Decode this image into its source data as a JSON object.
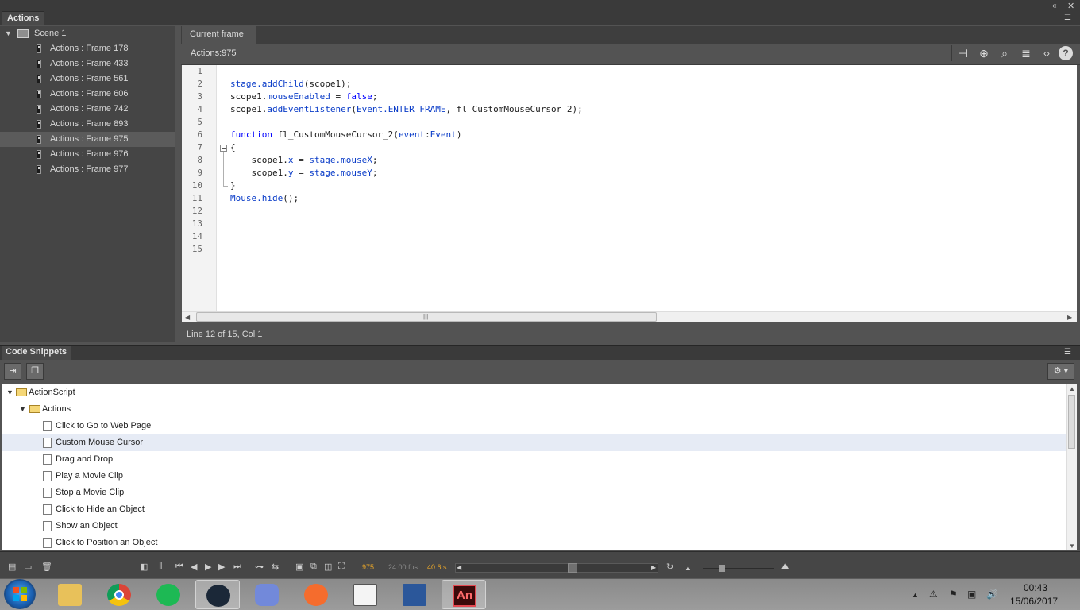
{
  "actions_panel": {
    "title": "Actions"
  },
  "tree": {
    "scene": "Scene 1",
    "items": [
      "Actions : Frame 178",
      "Actions : Frame 433",
      "Actions : Frame 561",
      "Actions : Frame 606",
      "Actions : Frame 742",
      "Actions : Frame 893",
      "Actions : Frame 975",
      "Actions : Frame 976",
      "Actions : Frame 977"
    ],
    "selected_index": 6
  },
  "editor": {
    "tab": "Current frame",
    "crumb": "Actions:975",
    "line_numbers": [
      "1",
      "2",
      "3",
      "4",
      "5",
      "6",
      "7",
      "8",
      "9",
      "10",
      "11",
      "12",
      "13",
      "14",
      "15"
    ],
    "status": "Line 12 of 15, Col 1"
  },
  "code": {
    "l2a": "stage.addChild",
    "l2b": "(scope1);",
    "l3a": "scope1.",
    "l3b": "mouseEnabled",
    "l3c": " = ",
    "l3d": "false",
    "l3e": ";",
    "l4a": "scope1.",
    "l4b": "addEventListener",
    "l4c": "(",
    "l4d": "Event.ENTER_FRAME",
    "l4e": ", fl_CustomMouseCursor_2);",
    "l6a": "function",
    "l6b": " fl_CustomMouseCursor_2(",
    "l6c": "event",
    "l6d": ":",
    "l6e": "Event",
    "l6f": ")",
    "l7": "{",
    "l8a": "    scope1.",
    "l8b": "x",
    "l8c": " = ",
    "l8d": "stage.mouseX",
    "l8e": ";",
    "l9a": "    scope1.",
    "l9b": "y",
    "l9c": " = ",
    "l9d": "stage.mouseY",
    "l9e": ";",
    "l10": "}",
    "l11a": "Mouse.hide",
    "l11b": "();"
  },
  "snippets": {
    "title": "Code Snippets",
    "root": "ActionScript",
    "folder": "Actions",
    "items": [
      "Click to Go to Web Page",
      "Custom Mouse Cursor",
      "Drag and Drop",
      "Play a Movie Clip",
      "Stop a Movie Clip",
      "Click to Hide an Object",
      "Show an Object",
      "Click to Position an Object"
    ],
    "selected_index": 1
  },
  "timeline": {
    "frame": "975",
    "fps": "24.00 fps",
    "time": "40.6 s"
  },
  "taskbar": {
    "time": "00:43",
    "date": "15/06/2017",
    "apps": [
      "file-explorer",
      "chrome",
      "spotify",
      "steam",
      "discord",
      "origin",
      "notepad",
      "word",
      "animate"
    ],
    "animate_label": "An"
  }
}
